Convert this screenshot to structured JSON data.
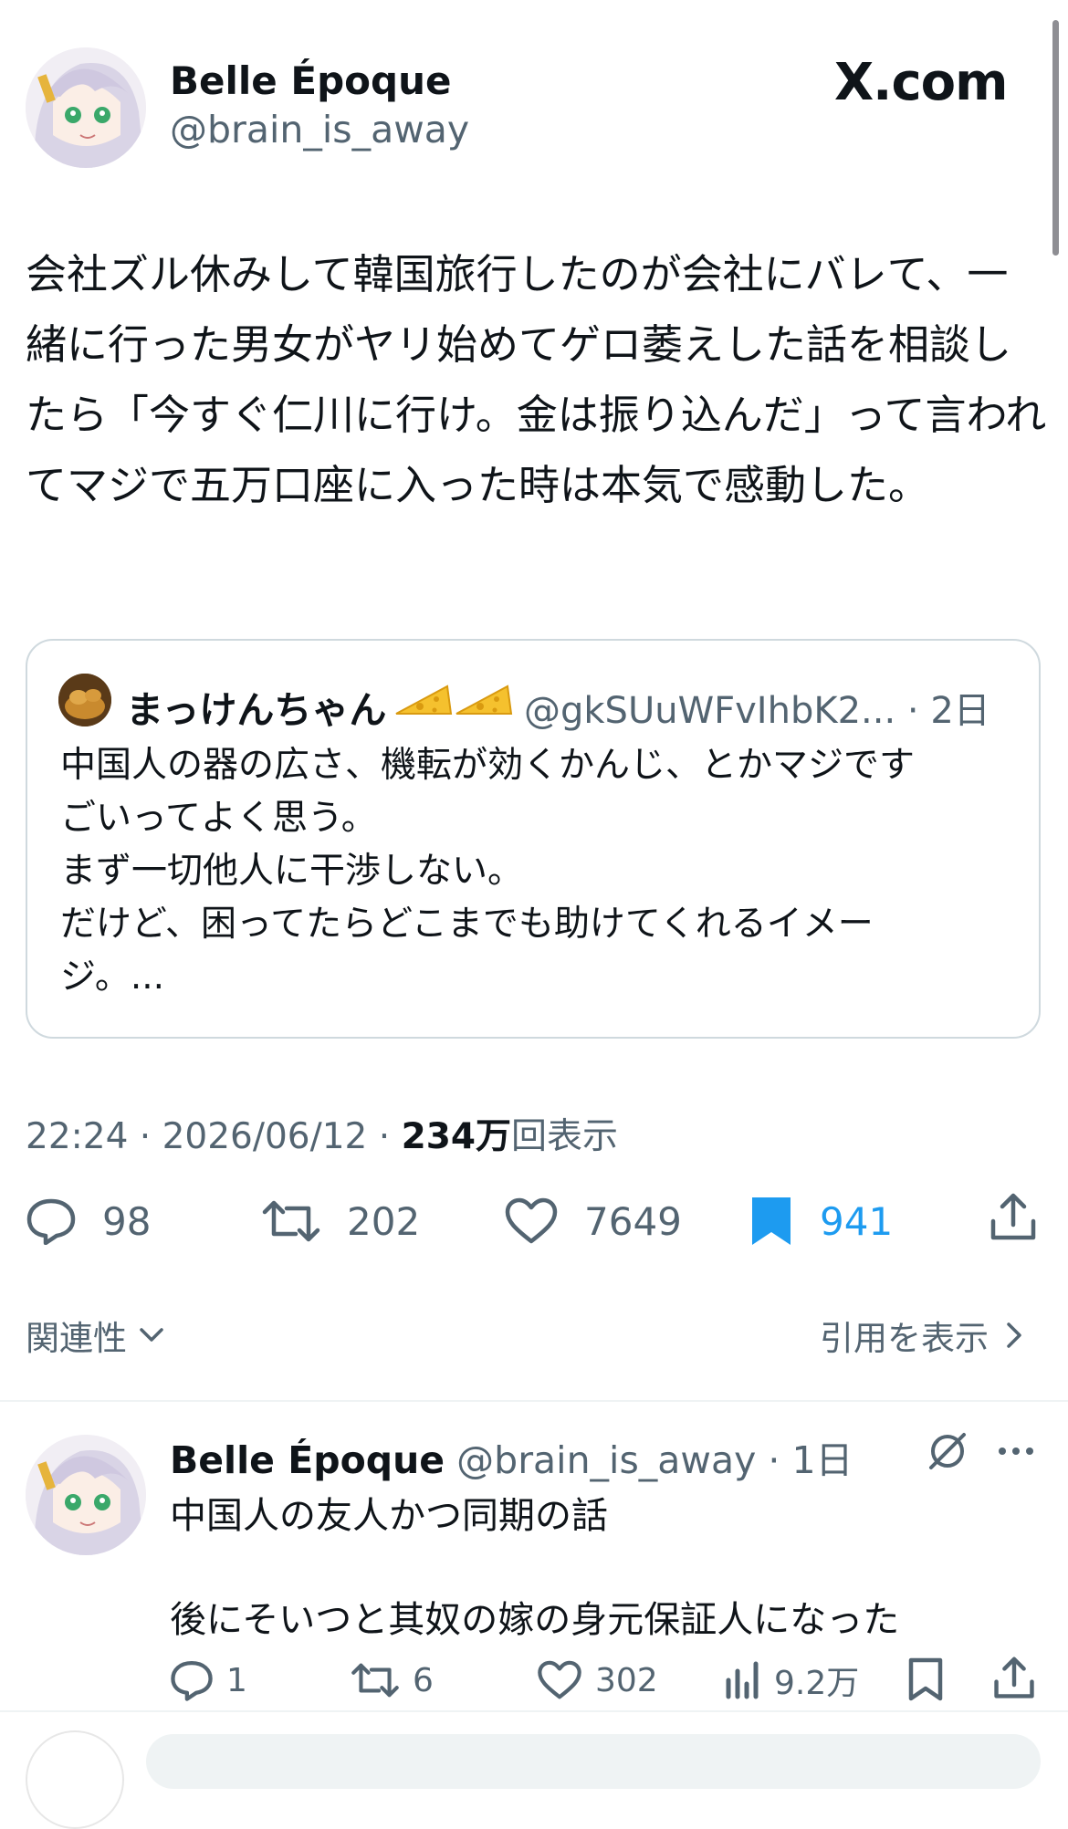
{
  "post": {
    "display_name": "Belle Époque",
    "handle": "@brain_is_away",
    "brand": "X.com",
    "text": "会社ズル休みして韓国旅行したのが会社にバレて、一緒に行った男女がヤリ始めてゲロ萎えした話を相談したら「今すぐ仁川に行け。金は振り込んだ」って言われてマジで五万口座に入った時は本気で感動した。",
    "timestamp": "22:24 · 2026/06/12 · ",
    "views_number": "234万",
    "views_label": "回表示"
  },
  "quote": {
    "display_name": "まっけんちゃん",
    "emoji": "🧀🧀",
    "handle_time": "@gkSUuWFvIhbK2... · 2日",
    "text": "中国人の器の広さ、機転が効くかんじ、とかマジです\nごいってよく思う。\nまず一切他人に干渉しない。\nだけど、困ってたらどこまでも助けてくれるイメー\nジ。..."
  },
  "actions": {
    "replies": "98",
    "reposts": "202",
    "likes": "7649",
    "bookmarks": "941"
  },
  "filters": {
    "sort_label": "関連性",
    "quotes_label": "引用を表示"
  },
  "reply": {
    "display_name": "Belle Époque",
    "handle_time": "@brain_is_away · 1日",
    "line1": "中国人の友人かつ同期の話",
    "line2": "後にそいつと其奴の嫁の身元保証人になった",
    "replies": "1",
    "reposts": "6",
    "likes": "302",
    "views": "9.2万"
  },
  "colors": {
    "accent": "#1d9bf0",
    "text": "#0f1419",
    "muted": "#536471",
    "border": "#cfd9de"
  },
  "icons": [
    "reply-icon",
    "repost-icon",
    "like-icon",
    "bookmark-icon",
    "share-icon",
    "views-icon",
    "grok-icon",
    "more-icon",
    "chevron-down-icon",
    "chevron-right-icon"
  ]
}
